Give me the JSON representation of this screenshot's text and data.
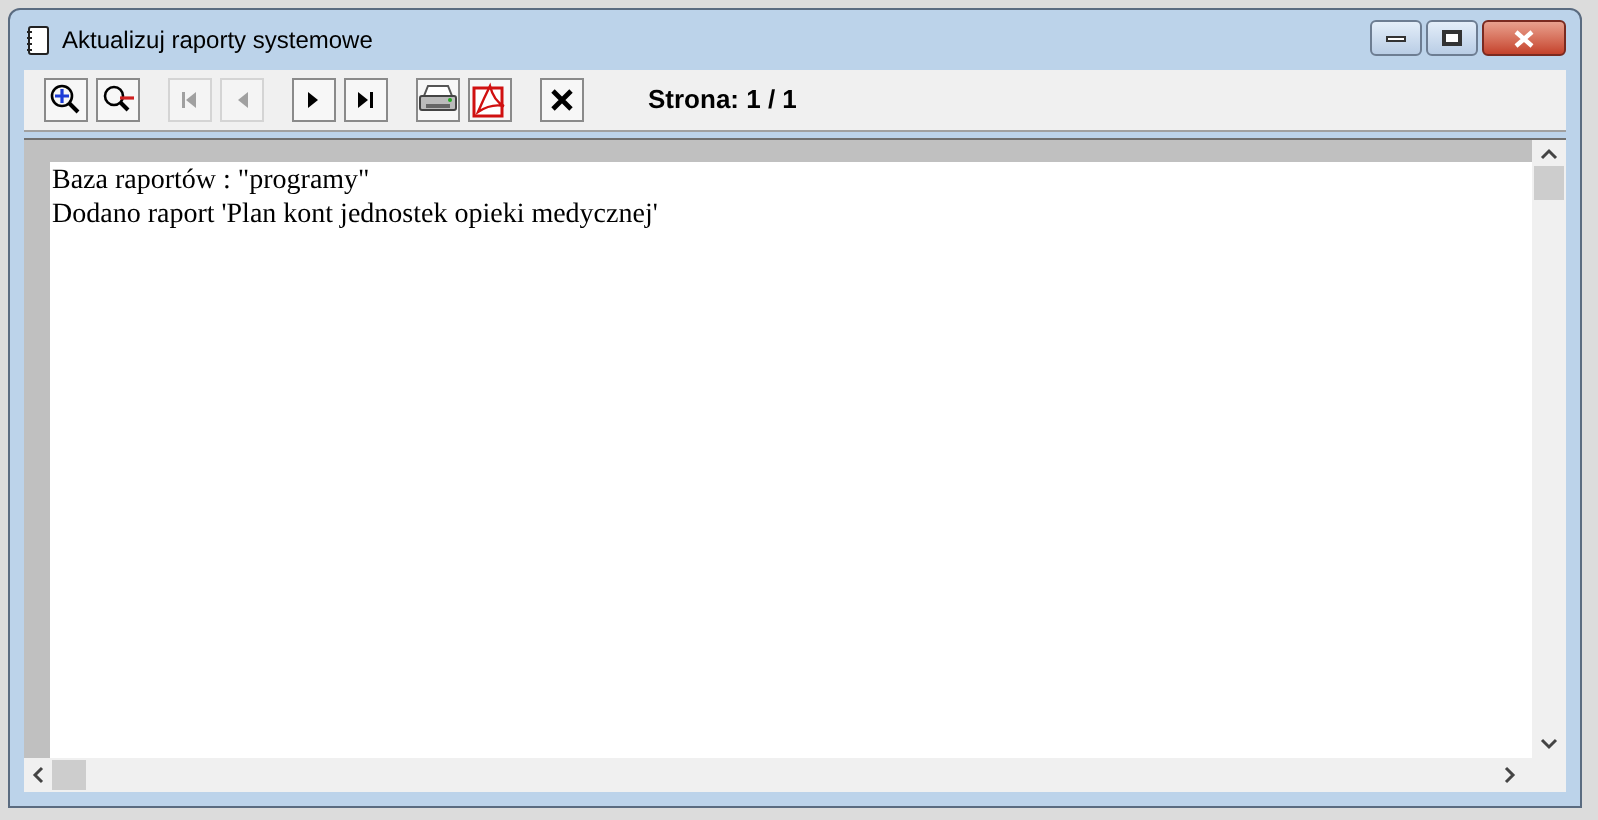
{
  "window": {
    "title": "Aktualizuj raporty systemowe"
  },
  "toolbar": {
    "buttons": [
      {
        "kind": "zoom-in",
        "disabled": false
      },
      {
        "kind": "zoom-out",
        "disabled": false
      },
      {
        "kind": "first",
        "disabled": true
      },
      {
        "kind": "prev",
        "disabled": true
      },
      {
        "kind": "next",
        "disabled": false
      },
      {
        "kind": "last",
        "disabled": false
      },
      {
        "kind": "print",
        "disabled": false
      },
      {
        "kind": "pdf",
        "disabled": false
      },
      {
        "kind": "close",
        "disabled": false
      }
    ],
    "page_label": "Strona: 1 / 1"
  },
  "report": {
    "lines": [
      "Baza raportów : \"programy\"",
      "Dodano raport 'Plan kont jednostek opieki medycznej'"
    ]
  }
}
